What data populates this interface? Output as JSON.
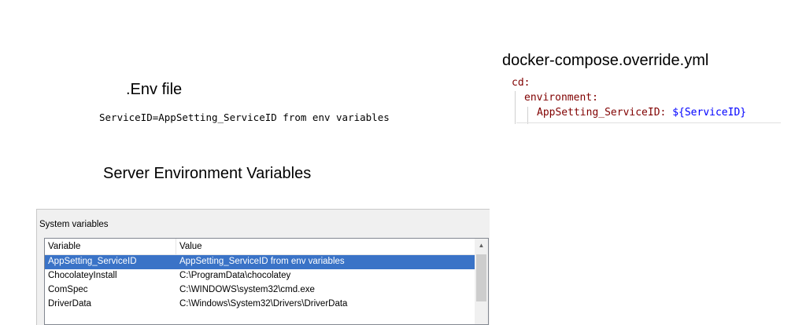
{
  "env_file": {
    "heading": ".Env file",
    "line": "ServiceID=AppSetting_ServiceID from env variables"
  },
  "server_env": {
    "heading": "Server Environment Variables"
  },
  "compose": {
    "heading": "docker-compose.override.yml",
    "lines": [
      {
        "key": "cd:",
        "value": ""
      },
      {
        "key": "environment:",
        "value": ""
      },
      {
        "key": "AppSetting_ServiceID: ",
        "value": "${ServiceID}"
      }
    ],
    "colors": {
      "key": "#800000",
      "value": "#0000ff"
    }
  },
  "system_variables": {
    "group_label": "System variables",
    "columns": [
      "Variable",
      "Value"
    ],
    "rows": [
      {
        "variable": "AppSetting_ServiceID",
        "value": "AppSetting_ServiceID from env variables",
        "selected": true
      },
      {
        "variable": "ChocolateyInstall",
        "value": "C:\\ProgramData\\chocolatey",
        "selected": false
      },
      {
        "variable": "ComSpec",
        "value": "C:\\WINDOWS\\system32\\cmd.exe",
        "selected": false
      },
      {
        "variable": "DriverData",
        "value": "C:\\Windows\\System32\\Drivers\\DriverData",
        "selected": false
      }
    ],
    "selection_color": "#3a73c7",
    "scroll_up_icon": "chevron-up-icon"
  }
}
